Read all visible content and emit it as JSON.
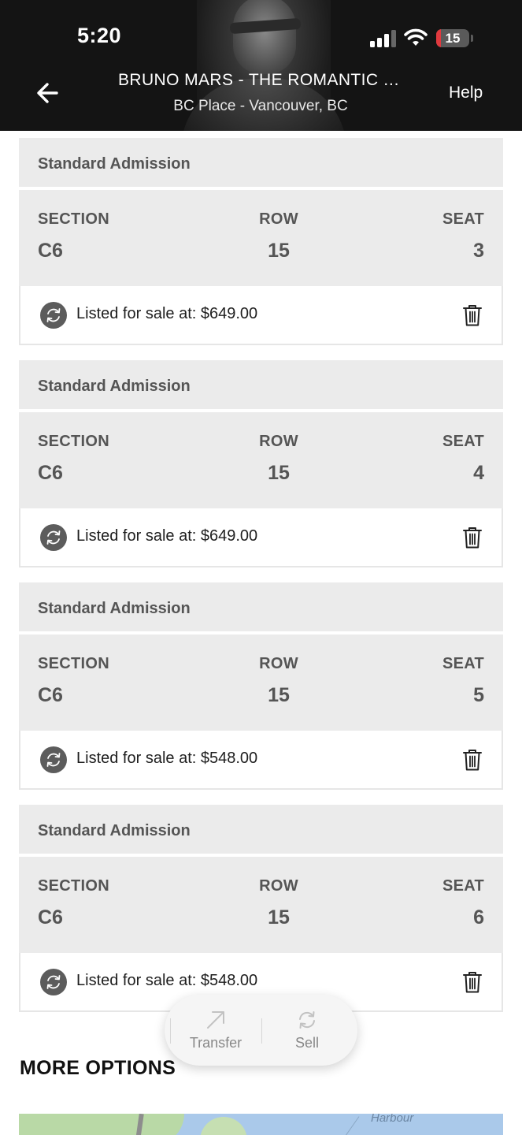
{
  "status_bar": {
    "time": "5:20",
    "battery_level": "15",
    "battery_fraction": 0.15
  },
  "header": {
    "title": "BRUNO MARS - THE ROMANTIC TOUR",
    "venue": "BC Place - Vancouver, BC",
    "help_label": "Help",
    "back_icon": "arrow-left-icon"
  },
  "labels": {
    "section": "SECTION",
    "row": "ROW",
    "seat": "SEAT"
  },
  "tickets": [
    {
      "type": "Standard Admission",
      "section": "C6",
      "row": "15",
      "seat": "3",
      "listing": "Listed for sale at: $649.00"
    },
    {
      "type": "Standard Admission",
      "section": "C6",
      "row": "15",
      "seat": "4",
      "listing": "Listed for sale at: $649.00"
    },
    {
      "type": "Standard Admission",
      "section": "C6",
      "row": "15",
      "seat": "5",
      "listing": "Listed for sale at: $548.00"
    },
    {
      "type": "Standard Admission",
      "section": "C6",
      "row": "15",
      "seat": "6",
      "listing": "Listed for sale at: $548.00"
    }
  ],
  "actions": {
    "transfer_label": "Transfer",
    "sell_label": "Sell"
  },
  "more_options": {
    "heading": "MORE OPTIONS",
    "map_label": "Harbour"
  },
  "colors": {
    "header_bg": "#141414",
    "card_bg": "#ebebeb",
    "battery_low": "#e0393e"
  }
}
